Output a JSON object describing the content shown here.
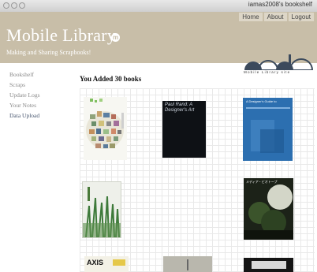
{
  "window": {
    "title": "iamas2008's bookshelf"
  },
  "topnav": [
    {
      "label": "Home"
    },
    {
      "label": "About"
    },
    {
      "label": "Logout"
    }
  ],
  "header": {
    "brand": "Mobile Library",
    "brand_mark": "m",
    "tagline": "Making and Sharing Scrapbooks!",
    "logo_text": "Mobile Library site"
  },
  "sidebar": {
    "items": [
      {
        "label": "Bookshelf"
      },
      {
        "label": "Scraps"
      },
      {
        "label": "Update Logs"
      },
      {
        "label": "Your Notes"
      },
      {
        "label": "Data Upload"
      }
    ]
  },
  "main": {
    "heading": "You Added 30 books",
    "books": [
      {
        "cover_title": ""
      },
      {
        "cover_title": "Paul Rand: A Designer's Art"
      },
      {
        "cover_title": "A Designer's Guide to"
      },
      {
        "cover_title": ""
      },
      {
        "cover_title": "メディア・ビオトープ"
      },
      {
        "cover_title": "AXIS"
      },
      {
        "cover_title": ""
      },
      {
        "cover_title": ""
      }
    ]
  },
  "colors": {
    "header_bg": "#c8bea8",
    "sidebar_active": "#4a5870",
    "sidebar_text": "#8a8a8a"
  }
}
